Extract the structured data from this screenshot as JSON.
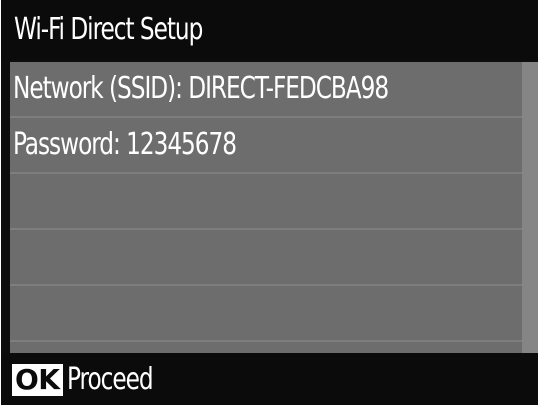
{
  "header": {
    "title": "Wi-Fi Direct Setup"
  },
  "info": {
    "rows": [
      {
        "text": "Network (SSID): DIRECT-FEDCBA98"
      },
      {
        "text": "Password: 12345678"
      },
      {
        "text": ""
      },
      {
        "text": ""
      },
      {
        "text": ""
      }
    ]
  },
  "footer": {
    "ok_key": "OK",
    "proceed_label": "Proceed"
  },
  "colors": {
    "background": "#0d0d0d",
    "content_panel": "#6d6d6d",
    "row_divider": "#7e7e7e",
    "scrollbar": "#858585",
    "text": "#ffffff"
  }
}
